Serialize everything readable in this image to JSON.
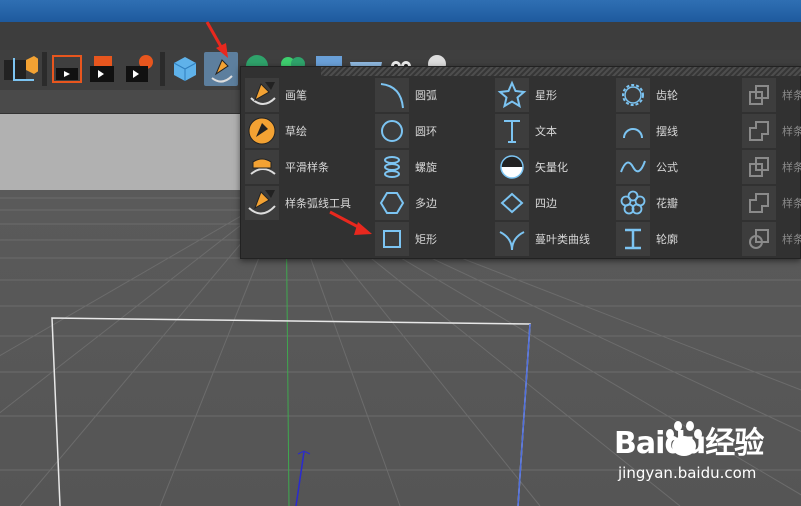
{
  "menu": {
    "columns": [
      {
        "items": [
          {
            "label": "画笔",
            "icon": "pen-tool-icon"
          },
          {
            "label": "草绘",
            "icon": "sketch-icon"
          },
          {
            "label": "平滑样条",
            "icon": "smooth-spline-icon"
          },
          {
            "label": "样条弧线工具",
            "icon": "spline-arc-tool-icon"
          }
        ]
      },
      {
        "items": [
          {
            "label": "圆弧",
            "icon": "arc-icon"
          },
          {
            "label": "圆环",
            "icon": "circle-icon"
          },
          {
            "label": "螺旋",
            "icon": "helix-icon"
          },
          {
            "label": "多边",
            "icon": "polygon-icon"
          },
          {
            "label": "矩形",
            "icon": "rectangle-icon"
          }
        ]
      },
      {
        "items": [
          {
            "label": "星形",
            "icon": "star-icon"
          },
          {
            "label": "文本",
            "icon": "text-icon"
          },
          {
            "label": "矢量化",
            "icon": "vectorize-icon"
          },
          {
            "label": "四边",
            "icon": "4-side-icon"
          },
          {
            "label": "蔓叶类曲线",
            "icon": "cissoid-icon"
          }
        ]
      },
      {
        "items": [
          {
            "label": "齿轮",
            "icon": "cogwheel-icon"
          },
          {
            "label": "摆线",
            "icon": "cycloid-icon"
          },
          {
            "label": "公式",
            "icon": "formula-icon"
          },
          {
            "label": "花瓣",
            "icon": "flower-icon"
          },
          {
            "label": "轮廓",
            "icon": "profile-icon"
          }
        ]
      },
      {
        "items": [
          {
            "label": "样条",
            "icon": "spline-op-icon"
          },
          {
            "label": "样条",
            "icon": "spline-op-icon"
          },
          {
            "label": "样条",
            "icon": "spline-op-icon"
          },
          {
            "label": "样条",
            "icon": "spline-op-icon"
          },
          {
            "label": "样条",
            "icon": "spline-op-icon"
          }
        ]
      }
    ]
  },
  "watermark": {
    "brand": "Baidu经验",
    "url": "jingyan.baidu.com"
  },
  "colors": {
    "accent": "#5d7f9e",
    "icon_blue": "#7cc4f2",
    "pen_orange": "#f3a233",
    "annotation_red": "#e8281e"
  }
}
